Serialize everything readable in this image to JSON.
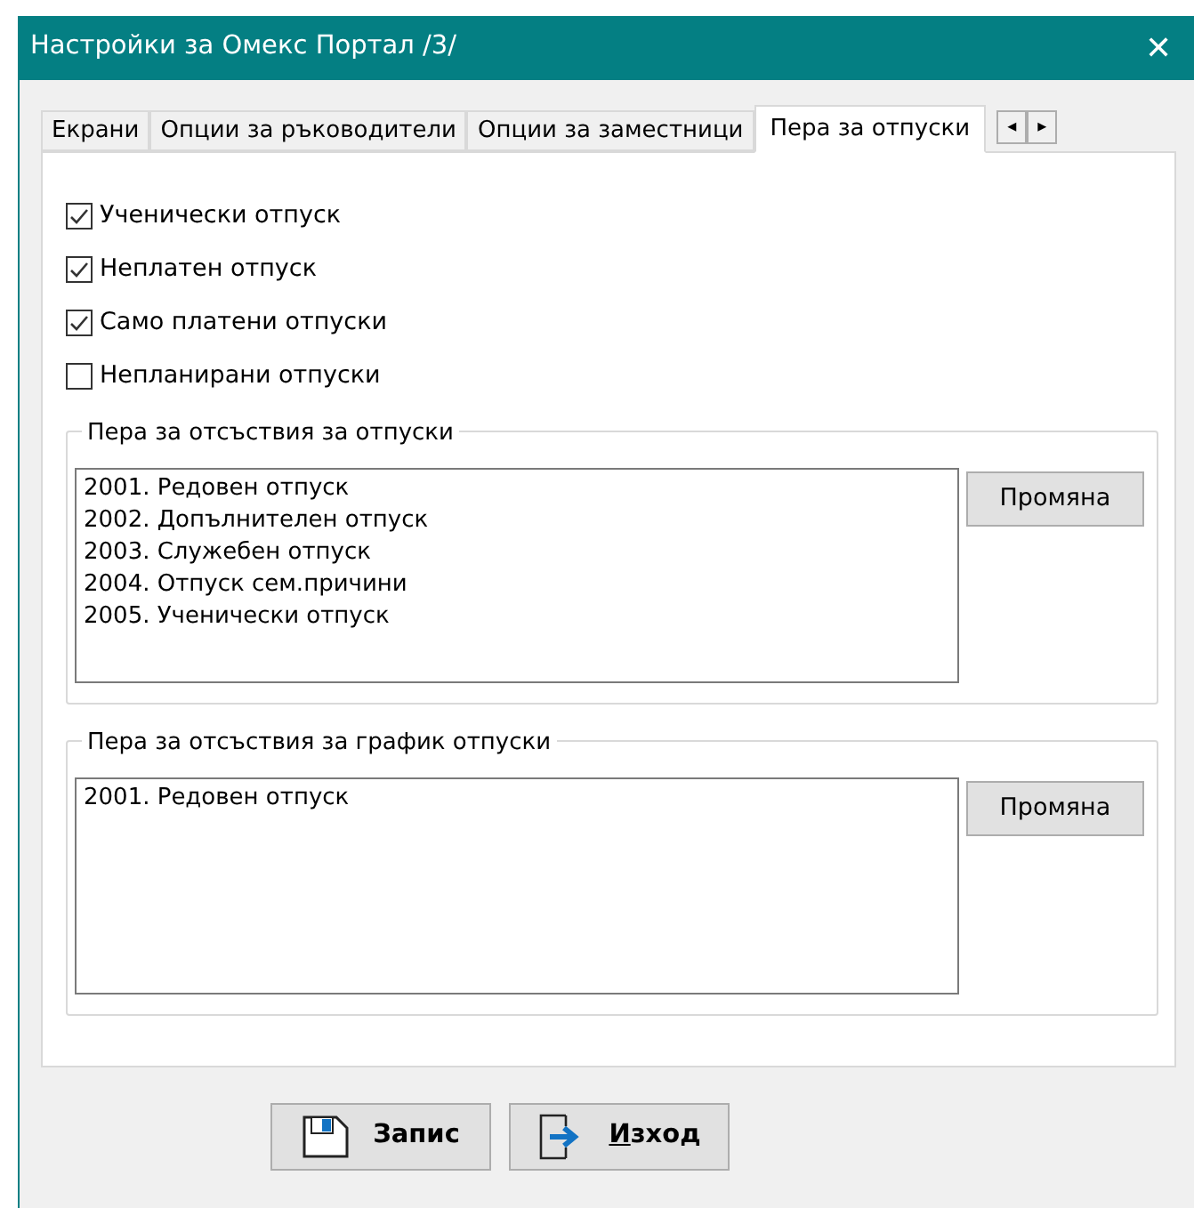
{
  "window": {
    "title": "Настройки за Омекс Портал /3/",
    "close": "✕"
  },
  "tabs": [
    {
      "label": "Екрани",
      "selected": false
    },
    {
      "label": "Опции за ръководители",
      "selected": false
    },
    {
      "label": "Опции за заместници",
      "selected": false
    },
    {
      "label": "Пера за отпуски",
      "selected": true
    }
  ],
  "tab_scroll": [
    "◂",
    "▸"
  ],
  "checkboxes": [
    {
      "label": "Ученически отпуск",
      "checked": true
    },
    {
      "label": "Неплатен отпуск",
      "checked": true
    },
    {
      "label": "Само платени отпуски",
      "checked": true
    },
    {
      "label": "Непланирани отпуски",
      "checked": false
    }
  ],
  "groups": [
    {
      "title": "Пера за отсъствия за отпуски",
      "items": [
        "2001. Редовен отпуск",
        "2002. Допълнителен отпуск",
        "2003. Служебен отпуск",
        "2004. Отпуск сем.причини",
        "2005. Ученически отпуск"
      ],
      "button": "Промяна"
    },
    {
      "title": "Пера за отсъствия за график отпуски",
      "items": [
        "2001. Редовен отпуск"
      ],
      "button": "Промяна"
    }
  ],
  "buttons": [
    {
      "kind": "save",
      "label": "Запис",
      "mnemonic": false
    },
    {
      "kind": "exit",
      "label": "Изход",
      "mnemonic": true
    }
  ]
}
